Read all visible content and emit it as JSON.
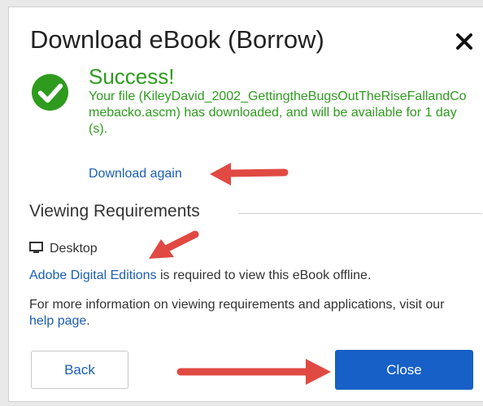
{
  "dialog": {
    "title": "Download eBook (Borrow)",
    "close_icon": "close-icon",
    "success": {
      "icon": "checkmark-circle-icon",
      "heading": "Success!",
      "message": "Your file (KileyDavid_2002_GettingtheBugsOutTheRiseFallandComebacko.ascm) has downloaded, and will be available for 1 day(s).",
      "download_again_label": "Download again"
    },
    "requirements": {
      "heading": "Viewing Requirements",
      "platform_icon": "desktop-icon",
      "platform_label": "Desktop",
      "software_link": "Adobe Digital Editions",
      "software_text": " is required to view this eBook offline.",
      "more_info_text": "For more information on viewing requirements and applications, visit our ",
      "help_link": "help page",
      "more_info_end": "."
    },
    "buttons": {
      "back_label": "Back",
      "close_label": "Close"
    }
  },
  "colors": {
    "success_green": "#2e9b1e",
    "link_blue": "#1a5fb4",
    "primary_button": "#1660c7",
    "annotation_arrow": "#e04a43"
  }
}
